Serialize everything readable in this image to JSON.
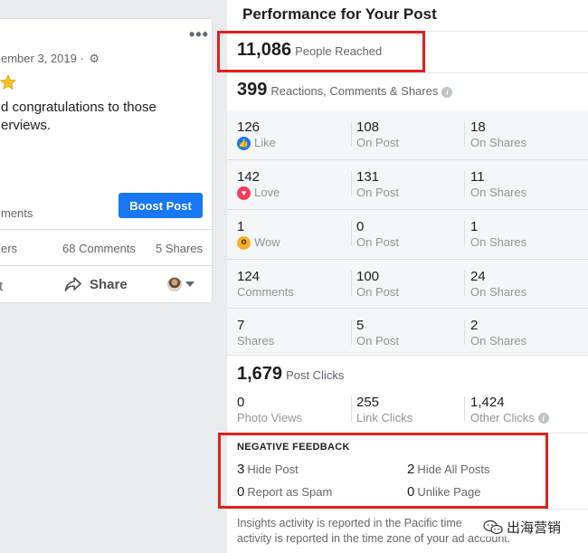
{
  "post": {
    "more_label": "•••",
    "date": "ember 3, 2019 ·",
    "settings_icon": "gear-icon",
    "star_icon": "star-icon",
    "text_line1": "d congratulations to those",
    "text_line2": "erviews.",
    "engagement_label": "ments",
    "boost_label": "Boost Post",
    "viewers_label": "ers",
    "comments_count": "68 Comments",
    "shares_count": "5 Shares",
    "action_left": "t",
    "share_label": "Share"
  },
  "panel": {
    "title": "Performance for Your Post",
    "reached": {
      "value": "11,086",
      "label": "People Reached"
    },
    "reactions_total": {
      "value": "399",
      "label": "Reactions, Comments & Shares"
    },
    "grid": [
      {
        "value": "126",
        "label": "Like",
        "icon": "like-icon",
        "on_post": "108",
        "on_post_label": "On Post",
        "on_shares": "18",
        "on_shares_label": "On Shares"
      },
      {
        "value": "142",
        "label": "Love",
        "icon": "love-icon",
        "on_post": "131",
        "on_post_label": "On Post",
        "on_shares": "11",
        "on_shares_label": "On Shares"
      },
      {
        "value": "1",
        "label": "Wow",
        "icon": "wow-icon",
        "on_post": "0",
        "on_post_label": "On Post",
        "on_shares": "1",
        "on_shares_label": "On Shares"
      },
      {
        "value": "124",
        "label": "Comments",
        "icon": "",
        "on_post": "100",
        "on_post_label": "On Post",
        "on_shares": "24",
        "on_shares_label": "On Shares"
      },
      {
        "value": "7",
        "label": "Shares",
        "icon": "",
        "on_post": "5",
        "on_post_label": "On Post",
        "on_shares": "2",
        "on_shares_label": "On Shares"
      }
    ],
    "post_clicks": {
      "value": "1,679",
      "label": "Post Clicks"
    },
    "clicks": [
      {
        "value": "0",
        "label": "Photo Views"
      },
      {
        "value": "255",
        "label": "Link Clicks"
      },
      {
        "value": "1,424",
        "label": "Other Clicks"
      }
    ],
    "negative_feedback": {
      "title": "NEGATIVE FEEDBACK",
      "hide_post": {
        "value": "3",
        "label": "Hide Post"
      },
      "hide_all": {
        "value": "2",
        "label": "Hide All Posts"
      },
      "report_spam": {
        "value": "0",
        "label": "Report as Spam"
      },
      "unlike_page": {
        "value": "0",
        "label": "Unlike Page"
      }
    },
    "footer_line1": "Insights activity is reported in the Pacific time",
    "footer_line2": "activity is reported in the time zone of your ad account."
  },
  "watermark": {
    "text": "出海营销"
  },
  "colors": {
    "accent": "#1877f2",
    "highlight": "#e02020",
    "love": "#f33e58",
    "wow": "#f7b125"
  }
}
